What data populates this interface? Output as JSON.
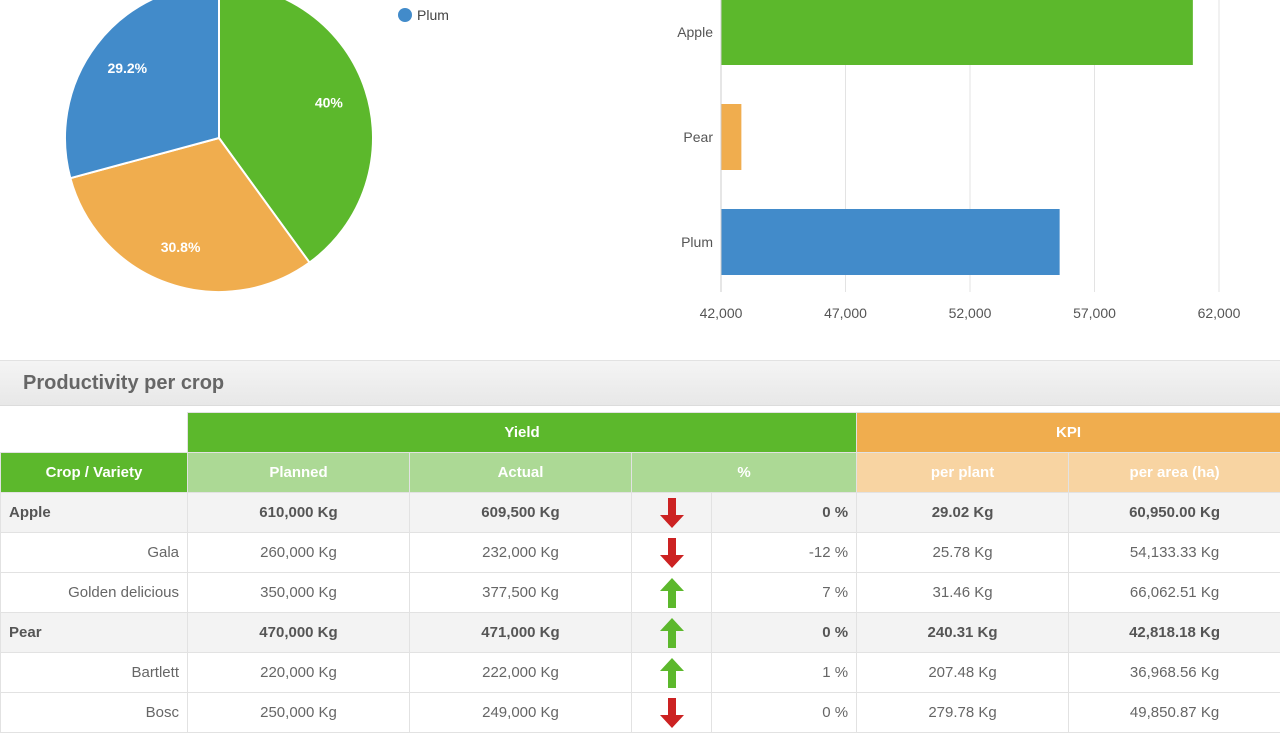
{
  "chart_data": [
    {
      "type": "pie",
      "series": [
        {
          "name": "Apple",
          "value": 40,
          "label": "40%",
          "color": "#5cb82c"
        },
        {
          "name": "Pear",
          "value": 30.8,
          "label": "30.8%",
          "color": "#f0ad4e"
        },
        {
          "name": "Plum",
          "value": 29.2,
          "label": "29.2%",
          "color": "#428bca"
        }
      ],
      "legend": {
        "placement": "top-right",
        "visible_entries": [
          "Plum"
        ]
      }
    },
    {
      "type": "bar",
      "orientation": "horizontal",
      "categories": [
        "Apple",
        "Pear",
        "Plum"
      ],
      "values": [
        60950,
        42818,
        55600
      ],
      "colors": [
        "#5cb82c",
        "#f0ad4e",
        "#428bca"
      ],
      "xlim": [
        42000,
        62000
      ],
      "xticks": [
        "42,000",
        "47,000",
        "52,000",
        "57,000",
        "62,000"
      ],
      "grid": true
    }
  ],
  "legend": {
    "plum_label": "Plum",
    "plum_color": "#428bca"
  },
  "table": {
    "title": "Productivity per crop",
    "groups": {
      "yield": "Yield",
      "kpi": "KPI"
    },
    "headers": {
      "crop": "Crop / Variety",
      "planned": "Planned",
      "actual": "Actual",
      "pct": "%",
      "per_plant": "per plant",
      "per_area": "per area (ha)"
    },
    "rows": [
      {
        "crop": "Apple",
        "planned": "610,000 Kg",
        "actual": "609,500 Kg",
        "pct": "0 %",
        "dir": "down",
        "per_plant": "29.02 Kg",
        "per_area": "60,950.00 Kg",
        "group": true
      },
      {
        "crop": "Gala",
        "planned": "260,000 Kg",
        "actual": "232,000 Kg",
        "pct": "-12 %",
        "dir": "down",
        "per_plant": "25.78 Kg",
        "per_area": "54,133.33 Kg",
        "group": false
      },
      {
        "crop": "Golden delicious",
        "planned": "350,000 Kg",
        "actual": "377,500 Kg",
        "pct": "7 %",
        "dir": "up",
        "per_plant": "31.46 Kg",
        "per_area": "66,062.51 Kg",
        "group": false
      },
      {
        "crop": "Pear",
        "planned": "470,000 Kg",
        "actual": "471,000 Kg",
        "pct": "0 %",
        "dir": "up",
        "per_plant": "240.31 Kg",
        "per_area": "42,818.18 Kg",
        "group": true
      },
      {
        "crop": "Bartlett",
        "planned": "220,000 Kg",
        "actual": "222,000 Kg",
        "pct": "1 %",
        "dir": "up",
        "per_plant": "207.48 Kg",
        "per_area": "36,968.56 Kg",
        "group": false
      },
      {
        "crop": "Bosc",
        "planned": "250,000 Kg",
        "actual": "249,000 Kg",
        "pct": "0 %",
        "dir": "down",
        "per_plant": "279.78 Kg",
        "per_area": "49,850.87 Kg",
        "group": false
      }
    ],
    "arrow_colors": {
      "up": "#5cb82c",
      "down": "#cc2222"
    }
  }
}
